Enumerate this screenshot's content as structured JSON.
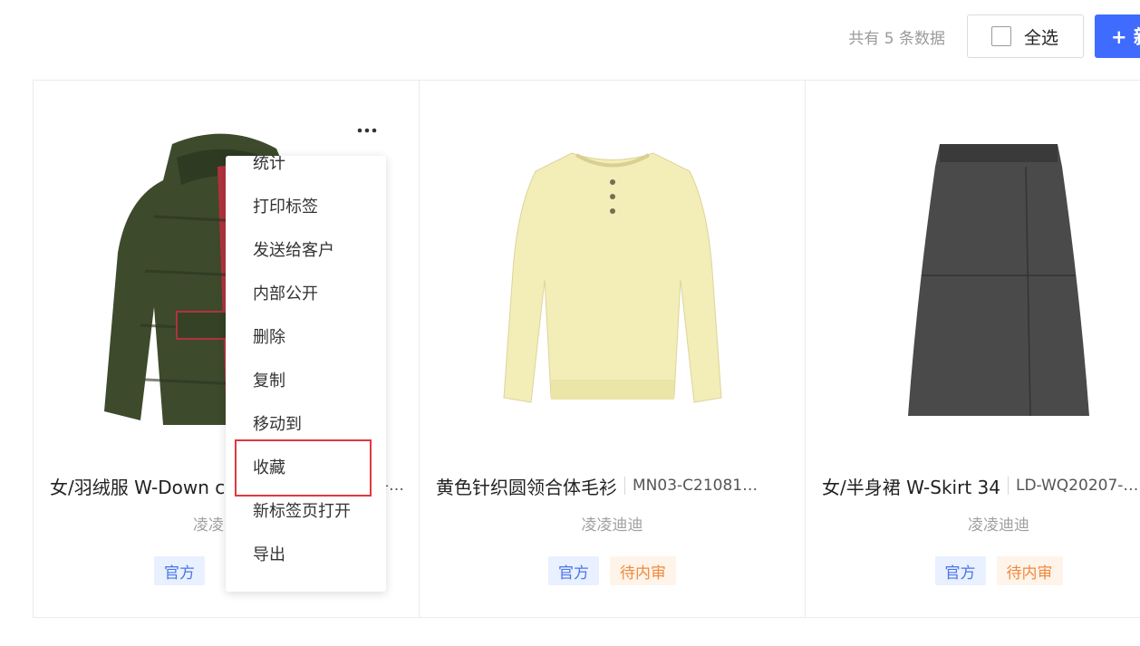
{
  "toolbar": {
    "count_text": "共有 5 条数据",
    "select_all_label": "全选",
    "new_button_label": "+ 新"
  },
  "cards": [
    {
      "name": "女/羽绒服 W-Down c",
      "code": "i-…",
      "owner": "凌凌",
      "tags": [
        "官方"
      ],
      "image": "green-down-jacket"
    },
    {
      "name": "黄色针织圆领合体毛衫",
      "code": "MN03-C21081…",
      "owner": "凌凌迪迪",
      "tags": [
        "官方",
        "待内审"
      ],
      "image": "yellow-knit-sweater"
    },
    {
      "name": "女/半身裙 W-Skirt 34",
      "code": "LD-WQ20207-…",
      "owner": "凌凌迪迪",
      "tags": [
        "官方",
        "待内审"
      ],
      "image": "gray-a-line-skirt"
    }
  ],
  "context_menu": {
    "items": [
      "统计",
      "打印标签",
      "发送给客户",
      "内部公开",
      "删除",
      "复制",
      "移动到",
      "收藏",
      "新标签页打开",
      "导出"
    ],
    "highlighted_item": "收藏"
  },
  "colors": {
    "accent": "#3f6cff",
    "tag_official_bg": "#e9f0ff",
    "tag_official_text": "#4a76e8",
    "tag_pending_bg": "#fff4ea",
    "tag_pending_text": "#ef8a3f",
    "highlight_border": "#e0393e"
  }
}
